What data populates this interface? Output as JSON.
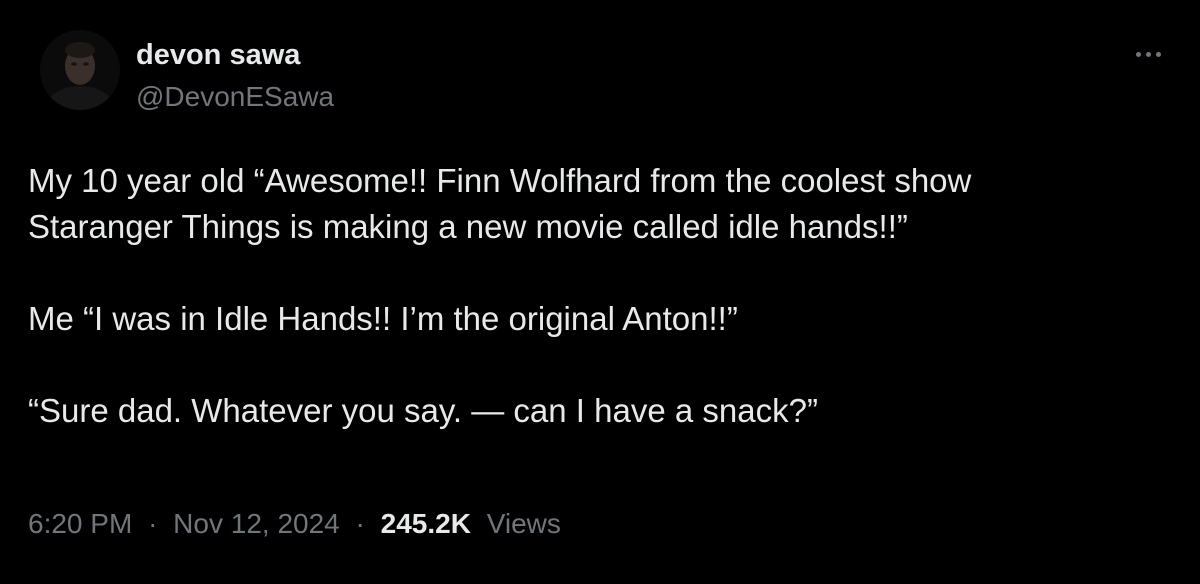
{
  "author": {
    "display_name": "devon sawa",
    "handle": "@DevonESawa"
  },
  "menu": {
    "icon": "more-horizontal-icon"
  },
  "tweet": {
    "line_1": "My 10 year old “Awesome!! Finn Wolfhard from the coolest show",
    "line_2": "Staranger Things is making a new movie called idle hands!!”",
    "line_3": "Me “I was in Idle Hands!! I’m the original Anton!!”",
    "line_4": "“Sure dad. Whatever you say. — can I have a snack?”"
  },
  "meta": {
    "time": "6:20 PM",
    "separator": "·",
    "date": "Nov 12, 2024",
    "views_count": "245.2K",
    "views_label": "Views"
  },
  "colors": {
    "background": "#000000",
    "primary_text": "#e7e9ea",
    "secondary_text": "#71767b"
  }
}
